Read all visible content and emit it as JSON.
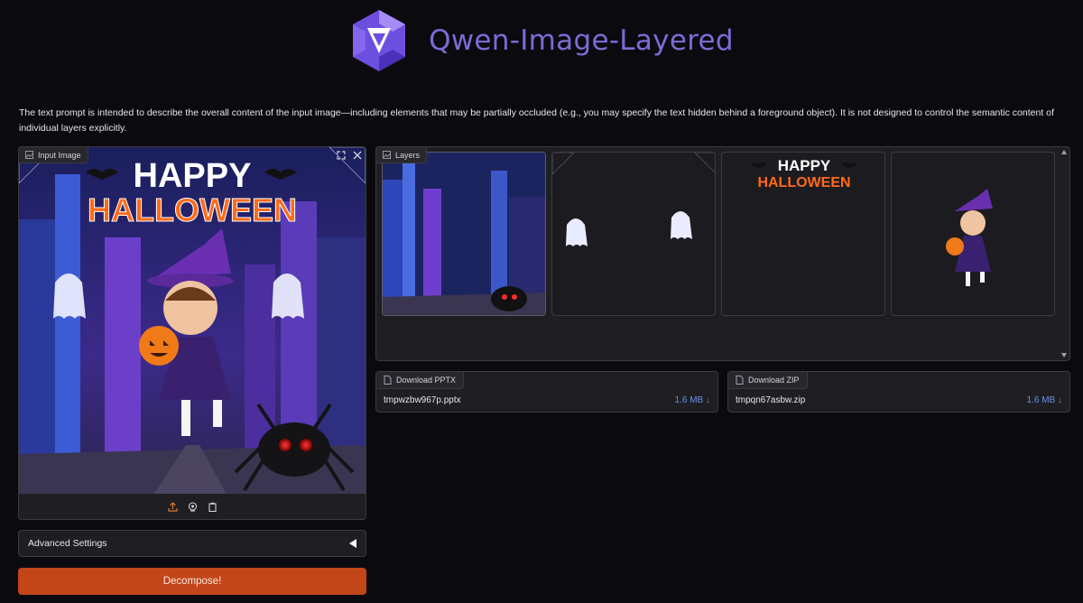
{
  "app": {
    "title": "Qwen-Image-Layered",
    "description": "The text prompt is intended to describe the overall content of the input image—including elements that may be partially occluded (e.g., you may specify the text hidden behind a foreground object). It is not designed to control the semantic content of individual layers explicitly."
  },
  "input_image": {
    "label": "Input Image",
    "artwork_text": {
      "line1": "HAPPY",
      "line2": "HALLOWEEN"
    },
    "corner_icons": [
      "fullscreen-icon",
      "close-icon"
    ],
    "toolbar_icons": [
      "upload-icon",
      "webcam-icon",
      "clipboard-icon"
    ]
  },
  "layers": {
    "label": "Layers",
    "thumbnails": [
      {
        "name": "city-street-with-spider"
      },
      {
        "name": "cobwebs-and-ghosts"
      },
      {
        "name": "happy-halloween-text",
        "text1": "HAPPY",
        "text2": "HALLOWEEN"
      },
      {
        "name": "witch-girl-with-pumpkin"
      }
    ]
  },
  "downloads": {
    "pptx": {
      "label": "Download PPTX",
      "filename": "tmpwzbw967p.pptx",
      "size": "1.6 MB ↓"
    },
    "zip": {
      "label": "Download ZIP",
      "filename": "tmpqn67asbw.zip",
      "size": "1.6 MB ↓"
    }
  },
  "advanced_settings": {
    "label": "Advanced Settings"
  },
  "decompose_button": {
    "label": "Decompose!"
  },
  "colors": {
    "background": "#0b0b0f",
    "panel": "#1f1f23",
    "accent": "#c2461a",
    "title": "#7c6bd6",
    "file_size": "#6b8fe0"
  }
}
